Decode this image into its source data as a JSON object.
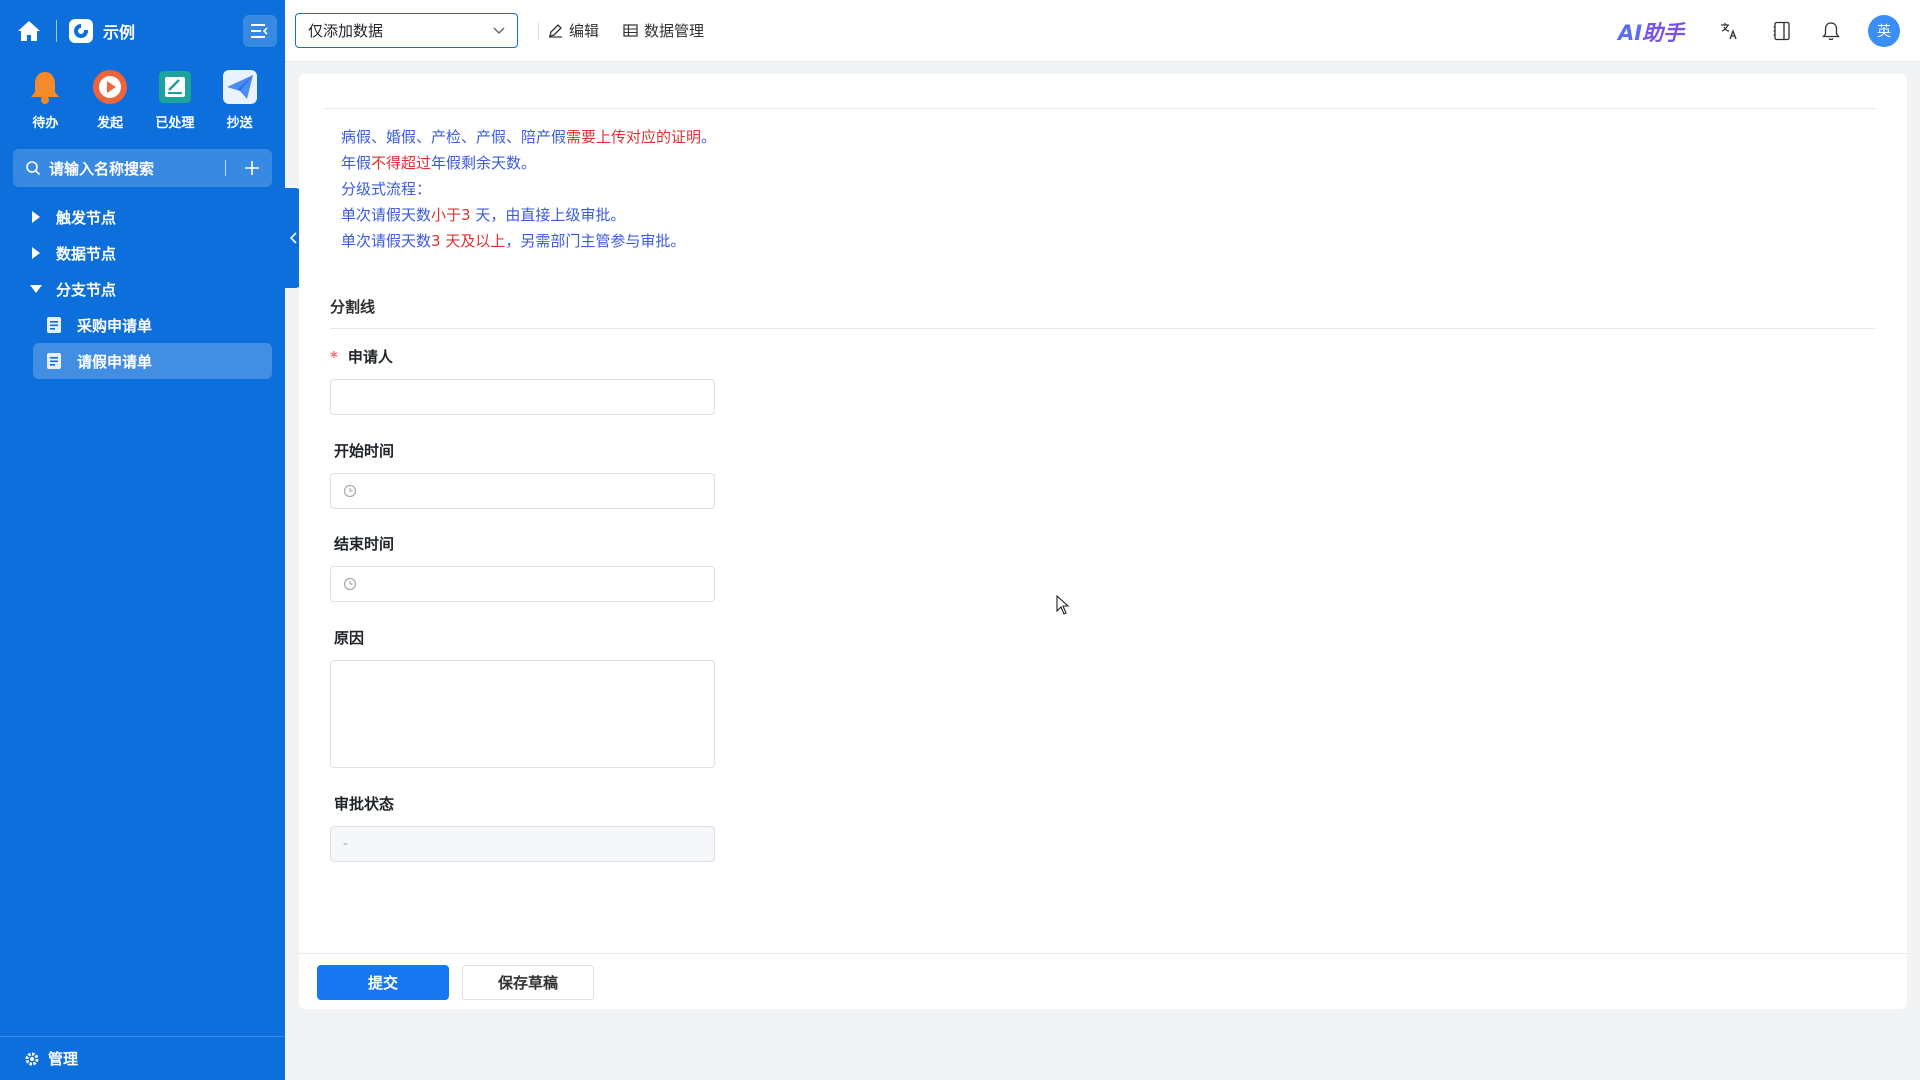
{
  "sidebar": {
    "app_name": "示例",
    "quick_actions": [
      {
        "label": "待办",
        "icon": "bell-icon",
        "color": "#f58a2a"
      },
      {
        "label": "发起",
        "icon": "play-icon",
        "color": "#f0643c"
      },
      {
        "label": "已处理",
        "icon": "checked-doc-icon",
        "color": "#1ba39c"
      },
      {
        "label": "抄送",
        "icon": "paper-plane-icon",
        "color": "#4a8df8"
      }
    ],
    "search_placeholder": "请输入名称搜索",
    "tree": {
      "groups": [
        {
          "label": "触发节点",
          "expanded": false
        },
        {
          "label": "数据节点",
          "expanded": false
        },
        {
          "label": "分支节点",
          "expanded": true
        }
      ],
      "leaves": [
        {
          "label": "采购申请单",
          "active": false
        },
        {
          "label": "请假申请单",
          "active": true
        }
      ]
    },
    "bottom_label": "管理"
  },
  "topbar": {
    "mode_select_value": "仅添加数据",
    "edit_label": "编辑",
    "data_manage_label": "数据管理",
    "ai_logo_ai": "AI",
    "ai_logo_text": "助手",
    "avatar_text": "英"
  },
  "form": {
    "description": {
      "line1_pre": "病假、婚假、产检、产假、陪产假",
      "line1_red": "需要上传对应的证明",
      "line1_post": "。",
      "line2_pre": "年假",
      "line2_red": "不得超过",
      "line2_post": "年假剩余天数。",
      "line3": "分级式流程：",
      "line4_pre": "单次请假天数",
      "line4_red": "小于3",
      "line4_post": " 天，由直接上级审批。",
      "line5_pre": "单次请假天数",
      "line5_red": "3 天及以上",
      "line5_post": "，另需部门主管参与审批。"
    },
    "divider_title": "分割线",
    "fields": {
      "applicant_label": "申请人",
      "applicant_required": "*",
      "start_label": "开始时间",
      "end_label": "结束时间",
      "reason_label": "原因",
      "status_label": "审批状态",
      "status_value": "-"
    },
    "submit_label": "提交",
    "save_draft_label": "保存草稿"
  },
  "colors": {
    "sidebar_bg": "#0c6fdc",
    "primary": "#1677f0",
    "desc_blue": "#3b5bdb",
    "desc_red": "#e03131"
  }
}
